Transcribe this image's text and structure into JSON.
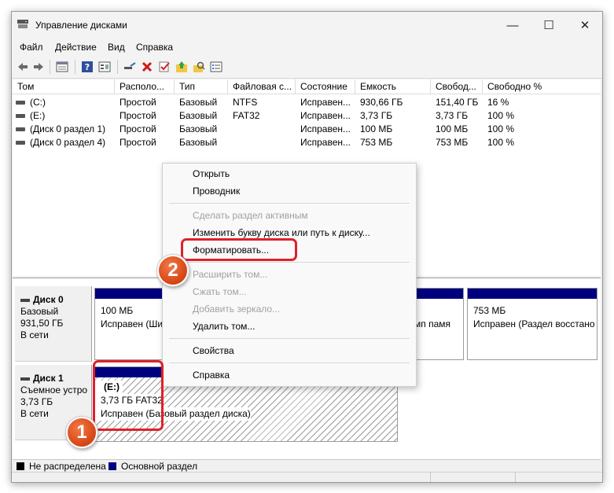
{
  "window": {
    "title": "Управление дисками",
    "controls": {
      "minimize": "—",
      "maximize": "☐",
      "close": "✕"
    }
  },
  "menu": [
    "Файл",
    "Действие",
    "Вид",
    "Справка"
  ],
  "toolbar": {
    "icons": [
      "back-arrow-icon",
      "forward-arrow-icon",
      "properties-icon",
      "help-icon",
      "view-icon",
      "connect-icon",
      "delete-icon",
      "check-icon",
      "up-folder-icon",
      "search-folder-icon",
      "list-icon"
    ]
  },
  "volume_table": {
    "columns": [
      "Том",
      "Располо...",
      "Тип",
      "Файловая с...",
      "Состояние",
      "Емкость",
      "Свобод...",
      "Свободно %"
    ],
    "rows": [
      [
        "(C:)",
        "Простой",
        "Базовый",
        "NTFS",
        "Исправен...",
        "930,66 ГБ",
        "151,40 ГБ",
        "16 %"
      ],
      [
        "(E:)",
        "Простой",
        "Базовый",
        "FAT32",
        "Исправен...",
        "3,73 ГБ",
        "3,73 ГБ",
        "100 %"
      ],
      [
        "(Диск 0 раздел 1)",
        "Простой",
        "Базовый",
        "",
        "Исправен...",
        "100 МБ",
        "100 МБ",
        "100 %"
      ],
      [
        "(Диск 0 раздел 4)",
        "Простой",
        "Базовый",
        "",
        "Исправен...",
        "753 МБ",
        "753 МБ",
        "100 %"
      ]
    ]
  },
  "disks": [
    {
      "name": "Диск 0",
      "type": "Базовый",
      "size": "931,50 ГБ",
      "status": "В сети",
      "partitions": [
        {
          "size": "100 МБ",
          "status": "Исправен (Ши"
        },
        {
          "size": "",
          "status": "мп памя"
        },
        {
          "size": "753 МБ",
          "status": "Исправен (Раздел восстано"
        }
      ]
    },
    {
      "name": "Диск 1",
      "type": "Съемное устро",
      "size": "3,73 ГБ",
      "status": "В сети",
      "partitions": [
        {
          "label": "(E:)",
          "size": "3,73 ГБ FAT32",
          "status": "Исправен (Базовый раздел диска)"
        }
      ]
    }
  ],
  "legend": [
    {
      "label": "Не распределена",
      "color": "#000000"
    },
    {
      "label": "Основной раздел",
      "color": "#00007f"
    }
  ],
  "context_menu": {
    "items": [
      {
        "label": "Открыть",
        "enabled": true
      },
      {
        "label": "Проводник",
        "enabled": true
      },
      {
        "label": "Сделать раздел активным",
        "enabled": false
      },
      {
        "label": "Изменить букву диска или путь к диску...",
        "enabled": true
      },
      {
        "label": "Форматировать...",
        "enabled": true
      },
      {
        "label": "Расширить том...",
        "enabled": false
      },
      {
        "label": "Сжать том...",
        "enabled": false
      },
      {
        "label": "Добавить зеркало...",
        "enabled": false
      },
      {
        "label": "Удалить том...",
        "enabled": true
      },
      {
        "label": "Свойства",
        "enabled": true
      },
      {
        "label": "Справка",
        "enabled": true
      }
    ]
  },
  "annotations": {
    "step1": "1",
    "step2": "2",
    "highlight_color": "#e0202a",
    "badge_color": "#e0562a"
  }
}
